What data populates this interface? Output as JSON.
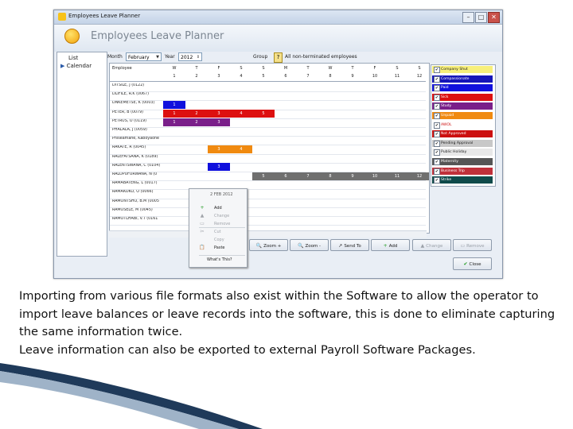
{
  "window": {
    "title": "Employees Leave Planner",
    "app_title": "Employees Leave Planner",
    "minimize": "–",
    "maximize": "□",
    "close": "✕"
  },
  "nav": {
    "items": [
      {
        "label": "List"
      },
      {
        "label": "Calendar",
        "arrow": "▶"
      }
    ]
  },
  "filters": {
    "month_label": "Month",
    "month_value": "February",
    "year_label": "Year",
    "year_value": "2012",
    "group_label": "Group",
    "group_value": "All non-terminated employees"
  },
  "grid": {
    "employee_header": "Employee",
    "days": [
      {
        "dow": "W",
        "num": "1"
      },
      {
        "dow": "T",
        "num": "2"
      },
      {
        "dow": "F",
        "num": "3"
      },
      {
        "dow": "S",
        "num": "4"
      },
      {
        "dow": "S",
        "num": "5"
      },
      {
        "dow": "M",
        "num": "6"
      },
      {
        "dow": "T",
        "num": "7"
      },
      {
        "dow": "W",
        "num": "8"
      },
      {
        "dow": "T",
        "num": "9"
      },
      {
        "dow": "F",
        "num": "10"
      },
      {
        "dow": "S",
        "num": "11"
      },
      {
        "dow": "S",
        "num": "12"
      }
    ],
    "employees": [
      "DITSILE, J (0122)",
      "DLIFILE, R.K (0067)",
      "DNKEMETSE, K (0003)",
      "PETER, B (0079)",
      "PETRUS, O (0119)",
      "PHALALA, J (0059)",
      "Phiseamane, Kaboyaone",
      "RAKATE, R (0045)",
      "RALEFATSANA, K (0189)",
      "RALENTSWANA, C (0104)",
      "RALOPUFURWANA, N (0",
      "RAMABATENG, L (0017)",
      "RAMAKOKO, O (0066)",
      "RAMONTSHO, B.M (0005",
      "RAMOSELE, M (0045)",
      "RAMOTLHABI, V.T (0161"
    ],
    "leave_rows": [
      {
        "row": 2,
        "color": "#1010dd",
        "days": [
          "1"
        ]
      },
      {
        "row": 3,
        "color": "#dd1010",
        "days": [
          "1",
          "2",
          "3",
          "4",
          "5"
        ]
      },
      {
        "row": 4,
        "color": "#7a1f8a",
        "days": [
          "1",
          "2",
          "3"
        ]
      },
      {
        "row": 7,
        "color": "#f08a10",
        "days": [
          "3",
          "4"
        ]
      },
      {
        "row": 9,
        "color": "#1010dd",
        "days": [
          "3"
        ]
      },
      {
        "row": 10,
        "color": "#6f6f6f",
        "days": [
          "5",
          "6",
          "7",
          "8",
          "9",
          "10",
          "11",
          "12"
        ]
      }
    ]
  },
  "context_menu": {
    "header": "2 FEB 2012",
    "items": [
      {
        "label": "Add",
        "icon": "+",
        "disabled": false
      },
      {
        "label": "Change",
        "icon": "▲",
        "disabled": true
      },
      {
        "label": "Remove",
        "icon": "▭",
        "disabled": true
      },
      {
        "label": "Cut",
        "icon": "✂",
        "disabled": true
      },
      {
        "label": "Copy",
        "icon": "",
        "disabled": true
      },
      {
        "label": "Paste",
        "icon": "📋",
        "disabled": false
      },
      {
        "label": "What's This?",
        "icon": "",
        "disabled": false
      }
    ]
  },
  "legend": {
    "items": [
      {
        "label": "Company Shut",
        "color": "#f7ef7a",
        "text": "#1b1b1b"
      },
      {
        "label": "Compassionate",
        "color": "#1515b8",
        "text": "#ffffff"
      },
      {
        "label": "Paid",
        "color": "#1010dd",
        "text": "#ffffff"
      },
      {
        "label": "Sick",
        "color": "#dd1010",
        "text": "#ffffff"
      },
      {
        "label": "Study",
        "color": "#7a1f8a",
        "text": "#ffffff"
      },
      {
        "label": "Unpaid",
        "color": "#f08a10",
        "text": "#ffffff"
      },
      {
        "label": "AWOL",
        "color": "#ffffff",
        "text": "#cc1010"
      },
      {
        "label": "Not Approved",
        "color": "#cc1010",
        "text": "#ffffff"
      },
      {
        "label": "Pending Approval",
        "color": "#c8c8c8",
        "text": "#1b1b1b"
      },
      {
        "label": "Public Holiday",
        "color": "#e8e8e8",
        "text": "#1b1b1b"
      },
      {
        "label": "Maternity",
        "color": "#555555",
        "text": "#ffffff"
      },
      {
        "label": "Business Trip",
        "color": "#c0303a",
        "text": "#ffffff"
      },
      {
        "label": "Strike",
        "color": "#0f4a4a",
        "text": "#ffffff"
      }
    ]
  },
  "buttons": {
    "zoom_in": "Zoom +",
    "zoom_out": "Zoom -",
    "send_to": "Send To",
    "add": "Add",
    "change": "Change",
    "remove": "Remove",
    "close": "Close"
  },
  "caption": {
    "p1": "Importing from various file formats also exist within the Software to allow the operator to import leave balances or leave records into the software, this is done to eliminate capturing the same information twice.",
    "p2": "Leave information can also be exported to external Payroll Software Packages."
  }
}
